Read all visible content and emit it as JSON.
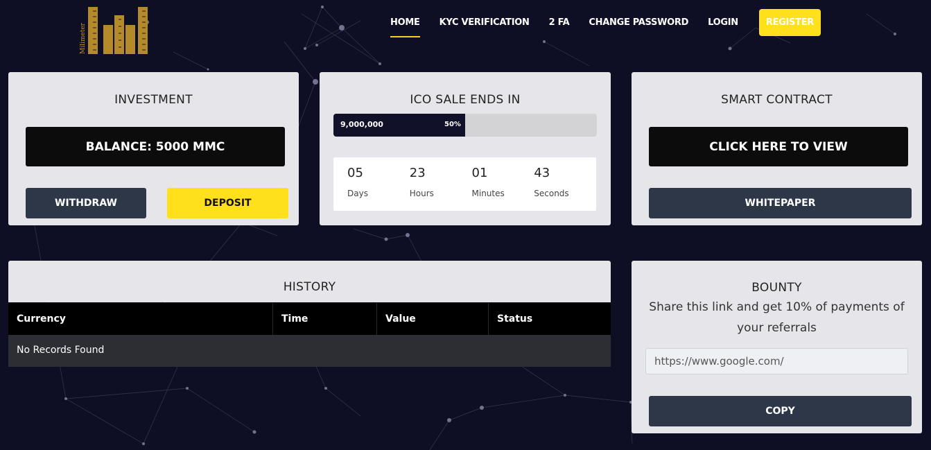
{
  "brand": {
    "logo_text": "Milimeter"
  },
  "nav": {
    "items": [
      {
        "label": "HOME"
      },
      {
        "label": "KYC VERIFICATION"
      },
      {
        "label": "2 FA"
      },
      {
        "label": "CHANGE PASSWORD"
      },
      {
        "label": "LOGIN"
      }
    ],
    "register_label": "REGISTER"
  },
  "investment": {
    "title": "INVESTMENT",
    "balance_label": "BALANCE: 5000 MMC",
    "withdraw_label": "WITHDRAW",
    "deposit_label": "DEPOSIT"
  },
  "ico": {
    "title": "ICO SALE ENDS IN",
    "progress_amount": "9,000,000",
    "progress_percent_label": "50%",
    "progress_fraction": 0.5,
    "countdown": [
      {
        "value": "05",
        "label": "Days"
      },
      {
        "value": "23",
        "label": "Hours"
      },
      {
        "value": "01",
        "label": "Minutes"
      },
      {
        "value": "43",
        "label": "Seconds"
      }
    ]
  },
  "smart_contract": {
    "title": "SMART CONTRACT",
    "view_label": "CLICK HERE TO VIEW",
    "whitepaper_label": "WHITEPAPER"
  },
  "history": {
    "title": "HISTORY",
    "columns": [
      "Currency",
      "Time",
      "Value",
      "Status"
    ],
    "empty_text": "No Records Found"
  },
  "bounty": {
    "title": "BOUNTY",
    "description": "Share this link and get 10% of payments of your referrals",
    "link_value": "https://www.google.com/",
    "copy_label": "COPY"
  },
  "colors": {
    "background": "#0e0e24",
    "accent_yellow": "#ffe01b",
    "dark_button": "#2d3748",
    "card": "#e6e6ea"
  }
}
